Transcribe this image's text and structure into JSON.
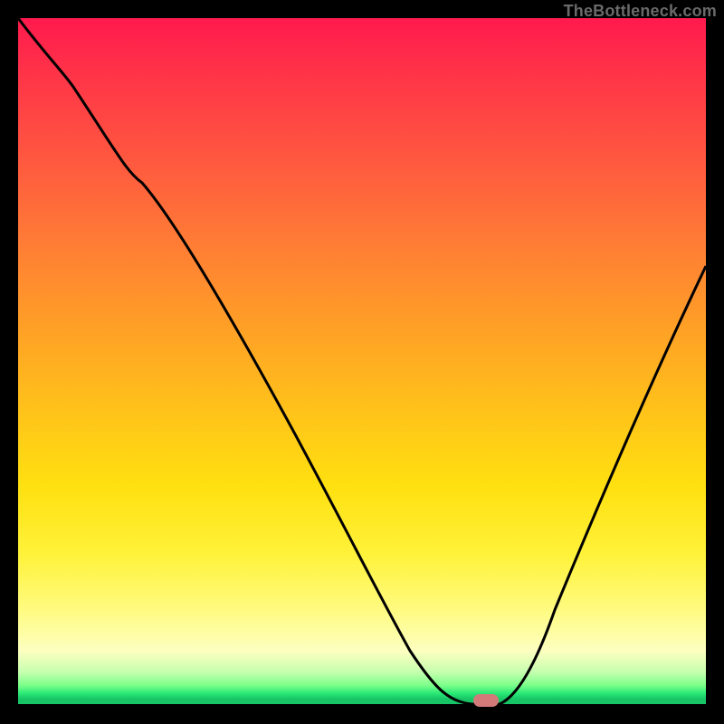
{
  "watermark": {
    "text": "TheBottleneck.com"
  },
  "chart_data": {
    "type": "line",
    "title": "",
    "xlabel": "",
    "ylabel": "",
    "xlim": [
      0,
      100
    ],
    "ylim": [
      0,
      100
    ],
    "grid": false,
    "legend": false,
    "series": [
      {
        "name": "bottleneck-curve",
        "x": [
          0,
          8,
          18,
          30,
          40,
          50,
          57,
          62,
          66,
          70,
          78,
          88,
          100
        ],
        "values": [
          100,
          90,
          76,
          57,
          40,
          24,
          12,
          4,
          0,
          0,
          14,
          36,
          64
        ]
      }
    ],
    "marker": {
      "x": 68,
      "y": 0,
      "color": "#d27a7a"
    },
    "background_gradient": {
      "direction": "vertical",
      "stops": [
        {
          "pos": 0,
          "color": "#ff1a4d"
        },
        {
          "pos": 45,
          "color": "#ffa026"
        },
        {
          "pos": 78,
          "color": "#fff23a"
        },
        {
          "pos": 96,
          "color": "#7dff8a"
        },
        {
          "pos": 100,
          "color": "#18c566"
        }
      ]
    }
  }
}
